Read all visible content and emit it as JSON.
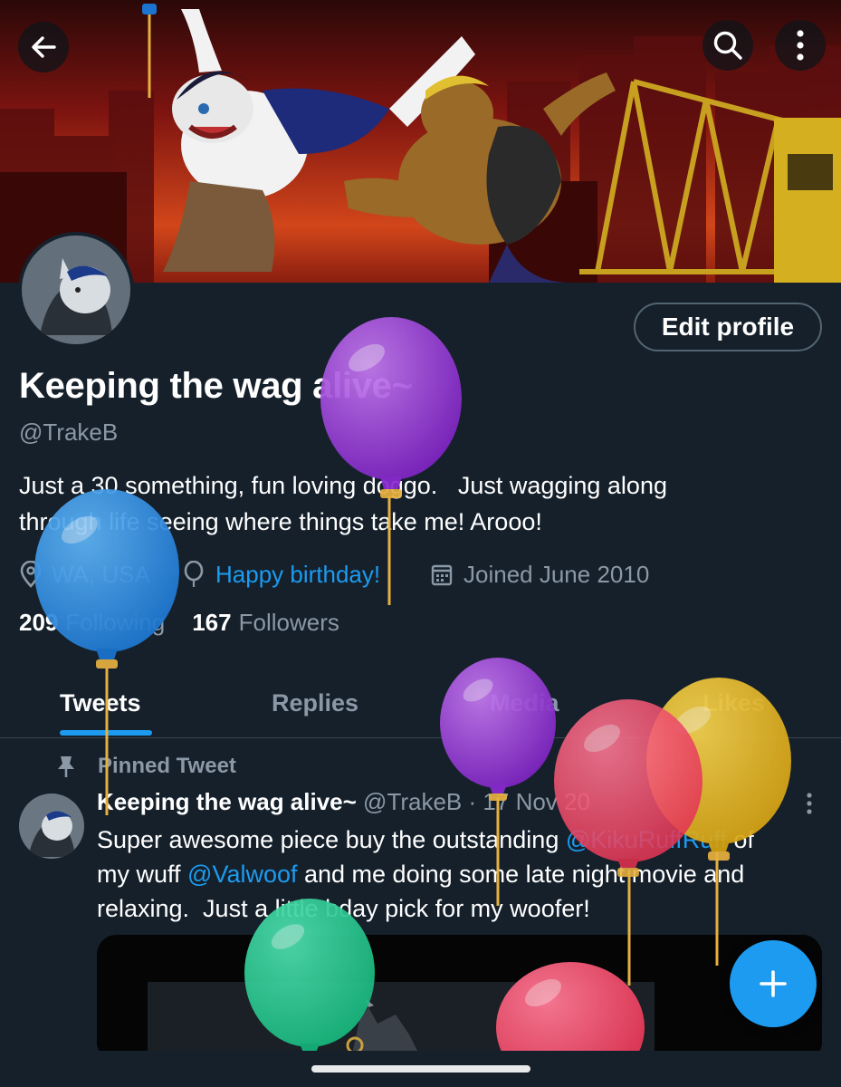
{
  "header": {
    "back_icon": "arrow-left-icon",
    "search_icon": "search-icon",
    "more_icon": "more-vertical-icon"
  },
  "profile": {
    "edit_button": "Edit profile",
    "display_name": "Keeping the wag alive~",
    "handle": "@TrakeB",
    "bio": "Just a 30 something, fun loving doggo.   Just wagging along\nthrough life seeing where things take me! Arooo!",
    "location": "WA, USA",
    "birthday": "Happy birthday!",
    "joined": "Joined June 2010",
    "following_count": "209",
    "following_label": "Following",
    "followers_count": "167",
    "followers_label": "Followers"
  },
  "tabs": [
    {
      "label": "Tweets",
      "active": true
    },
    {
      "label": "Replies",
      "active": false
    },
    {
      "label": "Media",
      "active": false
    },
    {
      "label": "Likes",
      "active": false
    }
  ],
  "pinned_tweet": {
    "pinned_label": "Pinned Tweet",
    "author_name": "Keeping the wag alive~",
    "author_handle": "@TrakeB",
    "separator": "·",
    "date": "17 Nov 20",
    "text_part1": "Super awesome piece buy the outstanding ",
    "mention1": "@KikuRuffRuff",
    "text_part2": " of\nmy wuff ",
    "mention2": "@Valwoof",
    "text_part3": " and me doing some late night movie and\nrelaxing.  Just a little bday pick for my woofer!"
  },
  "fab": {
    "icon": "plus-icon"
  },
  "colors": {
    "background": "#15202b",
    "accent": "#1d9bf0",
    "secondary_text": "#8b98a5",
    "border": "#38444d"
  }
}
